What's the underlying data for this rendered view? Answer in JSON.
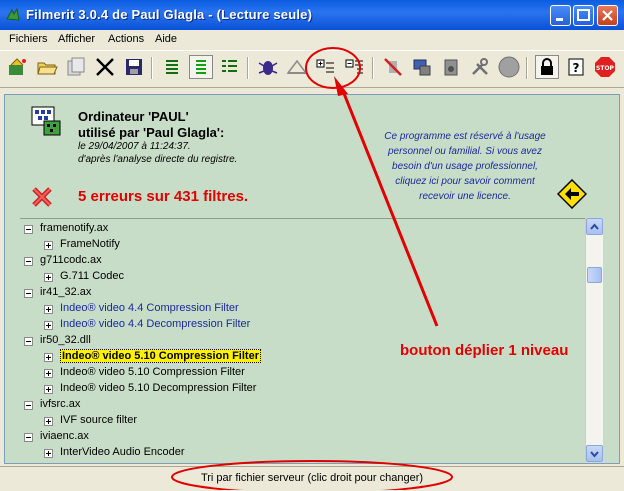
{
  "window": {
    "title": "Filmerit 3.0.4 de Paul Glagla - (Lecture seule)",
    "buttons": [
      "minimize-icon",
      "maximize-icon",
      "close-icon"
    ]
  },
  "menu": {
    "items": [
      "Fichiers",
      "Afficher",
      "Actions",
      "Aide"
    ]
  },
  "toolbar": {
    "icons": [
      "open-wizard-icon",
      "open-folder-icon",
      "copy-icon",
      "cut-icon",
      "save-icon",
      "list-view-icon",
      "list-view-selected-icon",
      "list-detail-icon",
      "bug-icon",
      "scale-icon",
      "expand-one-level-icon",
      "collapse-icon",
      "blocked-icon",
      "computer-icon",
      "sound-icon",
      "tools-icon",
      "disc-icon",
      "lock-icon",
      "help-icon",
      "stop-icon"
    ]
  },
  "header": {
    "computer_title": "Ordinateur 'PAUL'",
    "user_line": "utilisé par 'Paul Glagla':",
    "date_line": "le 29/04/2007 à 11:24:37.",
    "source_line": "d'après l'analyse directe du registre.",
    "errors": "5 erreurs sur 431 filtres.",
    "license_lines": [
      "Ce programme est réservé à l'usage",
      "personnel ou familial.  Si vous avez",
      "besoin d'un usage professionnel,",
      "cliquez ici pour savoir comment",
      "recevoir une licence."
    ]
  },
  "tree": [
    {
      "label": "framenotify.ax",
      "level": 0,
      "color": "black"
    },
    {
      "label": "FrameNotify",
      "level": 1,
      "color": "black"
    },
    {
      "label": "g711codc.ax",
      "level": 0,
      "color": "black"
    },
    {
      "label": "G.711 Codec",
      "level": 1,
      "color": "black"
    },
    {
      "label": "ir41_32.ax",
      "level": 0,
      "color": "black"
    },
    {
      "label": "Indeo® video 4.4 Compression Filter",
      "level": 1,
      "color": "blue"
    },
    {
      "label": "Indeo® video 4.4 Decompression Filter",
      "level": 1,
      "color": "blue"
    },
    {
      "label": "ir50_32.dll",
      "level": 0,
      "color": "black"
    },
    {
      "label": "Indeo® video 5.10 Compression Filter",
      "level": 1,
      "color": "highlight"
    },
    {
      "label": "Indeo® video 5.10 Compression Filter",
      "level": 1,
      "color": "black"
    },
    {
      "label": "Indeo® video 5.10 Decompression Filter",
      "level": 1,
      "color": "black"
    },
    {
      "label": "ivfsrc.ax",
      "level": 0,
      "color": "black"
    },
    {
      "label": "IVF source filter",
      "level": 1,
      "color": "black"
    },
    {
      "label": "iviaenc.ax",
      "level": 0,
      "color": "black"
    },
    {
      "label": "InterVideo Audio Encoder",
      "level": 1,
      "color": "black"
    }
  ],
  "status": {
    "text": "Tri par fichier serveur (clic droit pour changer)"
  },
  "annotation": {
    "text": "bouton déplier 1 niveau",
    "color": "#e00000"
  },
  "colors": {
    "pane_bg": "#c8ddc8",
    "title_blue": "#0a5ce0",
    "license_blue": "#1a2a9a"
  }
}
